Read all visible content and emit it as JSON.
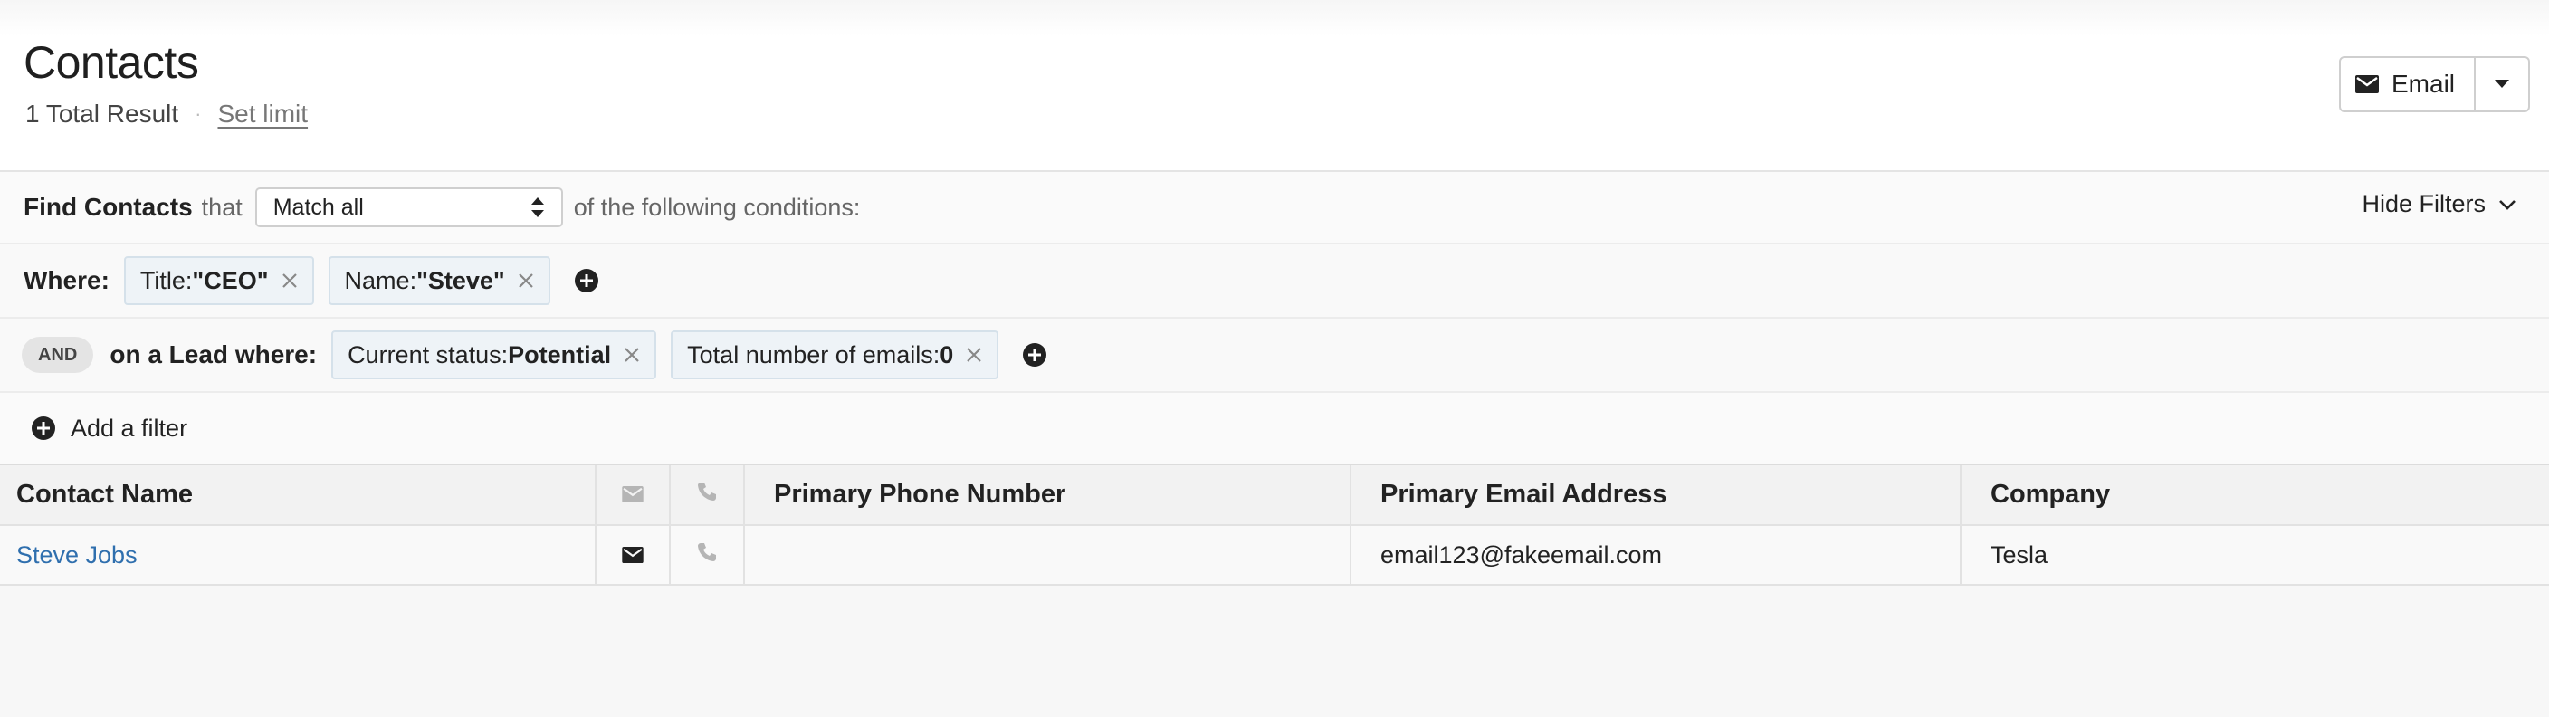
{
  "header": {
    "title": "Contacts",
    "result_count": "1 Total Result",
    "separator": "·",
    "set_limit": "Set limit",
    "email_button": "Email"
  },
  "filters": {
    "find_label": "Find Contacts",
    "that": "that",
    "match_select": "Match all",
    "conditions_text": "of the following conditions:",
    "hide_filters": "Hide Filters",
    "where_label": "Where:",
    "where_chips": [
      {
        "label": "Title: ",
        "value": "\"CEO\""
      },
      {
        "label": "Name: ",
        "value": "\"Steve\""
      }
    ],
    "and_label": "AND",
    "lead_label": "on a Lead where:",
    "lead_chips": [
      {
        "label": "Current status: ",
        "value": "Potential"
      },
      {
        "label": "Total number of emails: ",
        "value": "0"
      }
    ],
    "add_filter": "Add a filter"
  },
  "table": {
    "columns": [
      "Contact Name",
      "",
      "",
      "Primary Phone Number",
      "Primary Email Address",
      "Company"
    ],
    "rows": [
      {
        "contact_name": "Steve Jobs",
        "primary_phone": "",
        "primary_email": "email123@fakeemail.com",
        "company": "Tesla"
      }
    ]
  },
  "icons": {
    "email": "envelope-icon",
    "phone": "phone-icon",
    "remove": "close-icon",
    "add": "plus-circle-icon",
    "caret": "caret-down-icon",
    "chevron": "chevron-down-icon",
    "select_arrows": "select-arrows-icon"
  },
  "colors": {
    "link": "#2f6fae",
    "chip_bg": "#eef3f7",
    "chip_border": "#d5e1ea"
  }
}
